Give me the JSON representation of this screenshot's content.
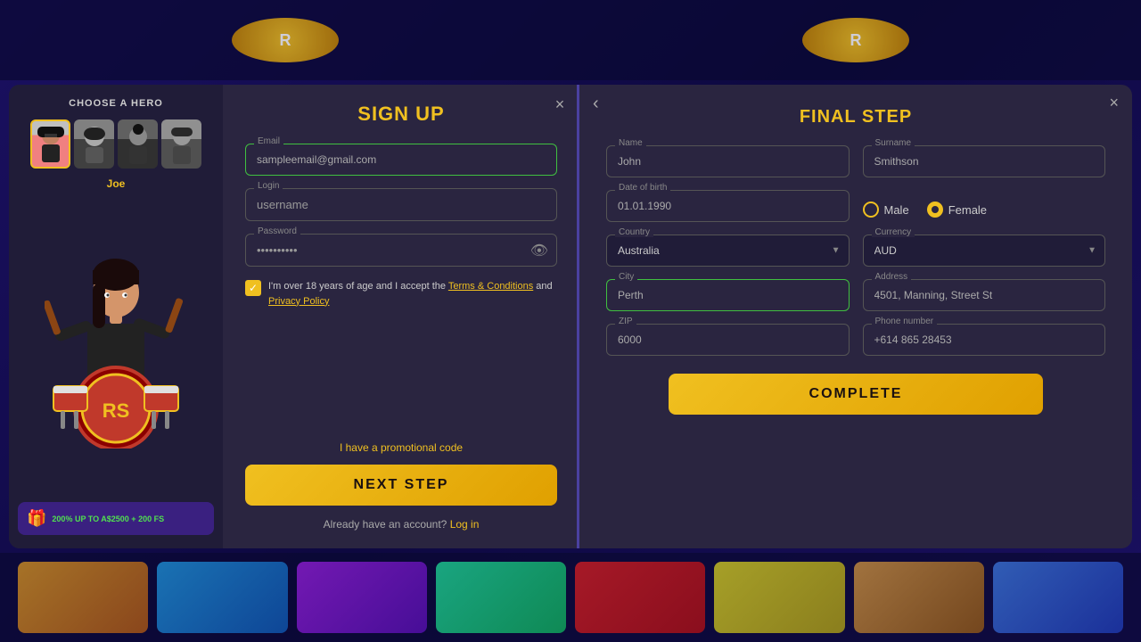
{
  "background": {
    "color": "#1a1060"
  },
  "hero_panel": {
    "title": "CHOOSE A HERO",
    "selected_name": "Joe",
    "avatars": [
      "avatar1",
      "avatar2",
      "avatar3",
      "avatar4"
    ]
  },
  "signup_modal": {
    "title": "SIGN UP",
    "close_label": "×",
    "email_label": "Email",
    "email_value": "sampleemail@gmail.com",
    "login_label": "Login",
    "login_value": "username",
    "password_label": "Password",
    "password_value": "••••••••••",
    "terms_text": "I'm over 18 years of age and I accept the",
    "terms_link": "Terms & Conditions",
    "and_text": "and",
    "privacy_link": "Privacy Policy",
    "promo_label": "I have a promotional code",
    "next_button": "NEXT STEP",
    "have_account_text": "Already have an account?",
    "login_link": "Log in"
  },
  "final_step_modal": {
    "title": "FINAL STEP",
    "back_label": "‹",
    "close_label": "×",
    "name_label": "Name",
    "name_value": "John",
    "surname_label": "Surname",
    "surname_value": "Smithson",
    "dob_label": "Date of birth",
    "dob_value": "01.01.1990",
    "gender_male": "Male",
    "gender_female": "Female",
    "country_label": "Country",
    "country_value": "Australia",
    "currency_label": "Currency",
    "currency_value": "AUD",
    "city_label": "City",
    "city_value": "Perth",
    "address_label": "Address",
    "address_value": "4501, Manning, Street St",
    "zip_label": "ZIP",
    "zip_value": "6000",
    "phone_label": "Phone number",
    "phone_value": "+614 865 28453",
    "complete_button": "COMPLETE"
  },
  "bonus_banner": {
    "text": "200% UP TO A$2500 +",
    "fs_text": "200 FS"
  }
}
